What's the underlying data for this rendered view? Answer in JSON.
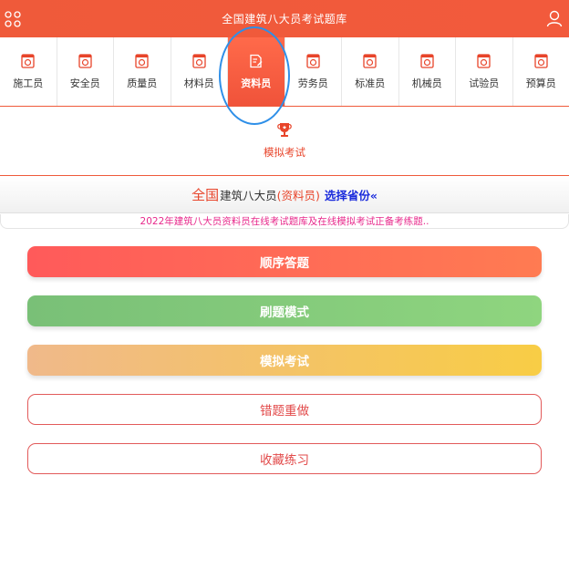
{
  "header": {
    "title": "全国建筑八大员考试题库",
    "left_icon": "apps-grid-icon",
    "right_icon": "user-icon",
    "accent_color": "#ef5a3a"
  },
  "roles": [
    {
      "label": "施工员",
      "icon": "exam-paper-icon",
      "active": false
    },
    {
      "label": "安全员",
      "icon": "exam-paper-icon",
      "active": false
    },
    {
      "label": "质量员",
      "icon": "exam-paper-icon",
      "active": false
    },
    {
      "label": "材料员",
      "icon": "exam-paper-icon",
      "active": false
    },
    {
      "label": "资料员",
      "icon": "edit-document-icon",
      "active": true
    },
    {
      "label": "劳务员",
      "icon": "exam-paper-icon",
      "active": false
    },
    {
      "label": "标准员",
      "icon": "exam-paper-icon",
      "active": false
    },
    {
      "label": "机械员",
      "icon": "exam-paper-icon",
      "active": false
    },
    {
      "label": "试验员",
      "icon": "exam-paper-icon",
      "active": false
    },
    {
      "label": "预算员",
      "icon": "exam-paper-icon",
      "active": false
    }
  ],
  "submenu": {
    "items": [
      {
        "label": "模拟考试",
        "icon": "trophy-icon"
      }
    ]
  },
  "selector": {
    "national": "全国",
    "name": "建筑八大员",
    "role": "(资料员)",
    "choose": "选择省份«"
  },
  "notice": {
    "text": "2022年建筑八大员资料员在线考试题库及在线模拟考试正备考练题.."
  },
  "actions": {
    "order": "顺序答题",
    "brush": "刷题模式",
    "mock": "模拟考试",
    "wrong": "错题重做",
    "favorites": "收藏练习"
  }
}
